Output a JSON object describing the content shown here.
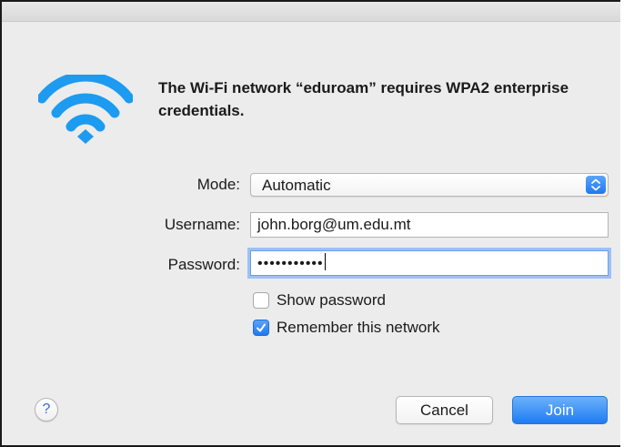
{
  "dialog": {
    "heading": "The Wi-Fi network “eduroam” requires WPA2 enterprise credentials.",
    "icon": "wifi-icon"
  },
  "form": {
    "mode": {
      "label": "Mode:",
      "value": "Automatic"
    },
    "username": {
      "label": "Username:",
      "value": "john.borg@um.edu.mt"
    },
    "password": {
      "label": "Password:",
      "value": "•••••••••••"
    },
    "show_password": {
      "label": "Show password",
      "checked": false
    },
    "remember_network": {
      "label": "Remember this network",
      "checked": true
    }
  },
  "buttons": {
    "help": "?",
    "cancel": "Cancel",
    "join": "Join"
  },
  "colors": {
    "accent": "#1f78f0",
    "wifi": "#1c9bf0",
    "background": "#ececec"
  }
}
